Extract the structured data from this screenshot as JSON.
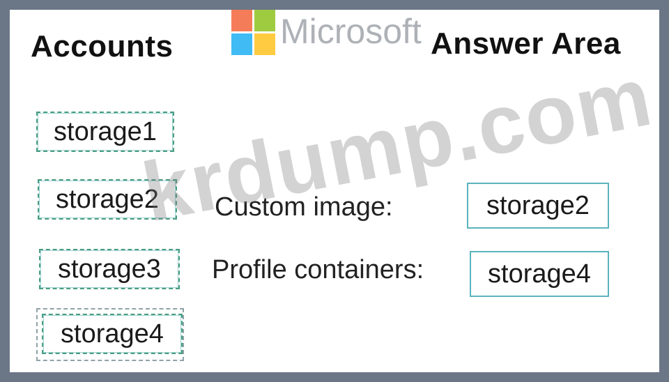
{
  "accounts_heading": "Accounts",
  "answer_heading": "Answer Area",
  "microsoft_logo_text": "Microsoft",
  "watermark_text": "krdump.com",
  "accounts": [
    "storage1",
    "storage2",
    "storage3",
    "storage4"
  ],
  "answers": [
    {
      "label": "Custom image:",
      "value": "storage2"
    },
    {
      "label": "Profile containers:",
      "value": "storage4"
    }
  ],
  "colors": {
    "frame": "#6b7686",
    "dashed_border": "#4a9e80",
    "answer_border": "#5bb3be"
  }
}
